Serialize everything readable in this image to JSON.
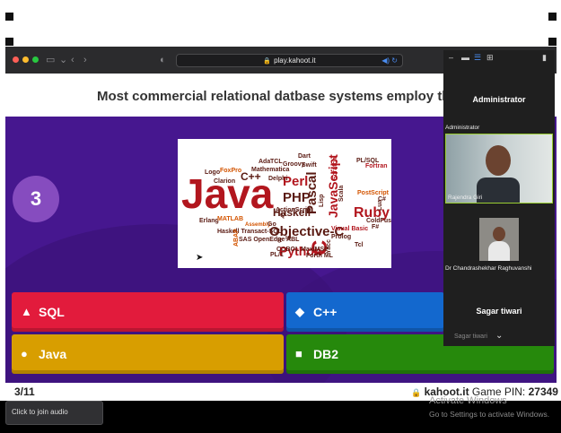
{
  "browser": {
    "url": "play.kahoot.it",
    "traffic_lights": [
      "#ff5f57",
      "#febc2e",
      "#28c840"
    ]
  },
  "question": {
    "text": "Most commercial relational datbase systems employ the langu",
    "timer": "3",
    "counter": "3/11"
  },
  "word_cloud": [
    {
      "t": "Java",
      "c": "#b2161e"
    },
    {
      "t": "Perl",
      "c": "#b2161e"
    },
    {
      "t": "PHP",
      "c": "#5a1a12"
    },
    {
      "t": "Haskell",
      "c": "#5a1a12"
    },
    {
      "t": "Pascal",
      "c": "#5a1a12"
    },
    {
      "t": "JavaScript",
      "c": "#b2161e"
    },
    {
      "t": "Ruby",
      "c": "#b2161e"
    },
    {
      "t": "Python",
      "c": "#b2161e"
    },
    {
      "t": "Objective-C",
      "c": "#5a1a12"
    },
    {
      "t": "C++",
      "c": "#5a1a12"
    },
    {
      "t": "C",
      "c": "#b2161e"
    },
    {
      "t": "Logo",
      "c": "#5a1a12"
    },
    {
      "t": "FoxPro",
      "c": "#d35400"
    },
    {
      "t": "Clarion",
      "c": "#5a1a12"
    },
    {
      "t": "Ada",
      "c": "#5a1a12"
    },
    {
      "t": "TCL",
      "c": "#5a1a12"
    },
    {
      "t": "Groovy",
      "c": "#5a1a12"
    },
    {
      "t": "Swift",
      "c": "#5a1a12"
    },
    {
      "t": "Dart",
      "c": "#5a1a12"
    },
    {
      "t": "Mathematica",
      "c": "#5a1a12"
    },
    {
      "t": "Delphi",
      "c": "#5a1a12"
    },
    {
      "t": "Scratch",
      "c": "#b2161e"
    },
    {
      "t": "Fortran",
      "c": "#b2161e"
    },
    {
      "t": "PL/SQL",
      "c": "#5a1a12"
    },
    {
      "t": "Scala",
      "c": "#5a1a12"
    },
    {
      "t": "PostScript",
      "c": "#d35400"
    },
    {
      "t": "C#",
      "c": "#5a1a12"
    },
    {
      "t": "ColdFusion",
      "c": "#5a1a12"
    },
    {
      "t": "Erlang",
      "c": "#5a1a12"
    },
    {
      "t": "MATLAB",
      "c": "#d35400"
    },
    {
      "t": "Assembly",
      "c": "#d35400"
    },
    {
      "t": "Haskell Transact-SQL",
      "c": "#5a1a12"
    },
    {
      "t": "SAS OpenEdge ABL",
      "c": "#5a1a12"
    },
    {
      "t": "COBOL Max/MSP",
      "c": "#5a1a12"
    },
    {
      "t": "PL/1",
      "c": "#5a1a12"
    },
    {
      "t": "ABAP",
      "c": "#d35400"
    },
    {
      "t": "Forth ML",
      "c": "#5a1a12"
    },
    {
      "t": "Visual Basic",
      "c": "#b2161e"
    },
    {
      "t": "Prolog",
      "c": "#5a1a12"
    },
    {
      "t": "F#",
      "c": "#5a1a12"
    },
    {
      "t": "Tcl",
      "c": "#5a1a12"
    },
    {
      "t": "Lua",
      "c": "#5a1a12"
    },
    {
      "t": "ActionScript",
      "c": "#5a1a12"
    },
    {
      "t": "Lisp",
      "c": "#5a1a12"
    },
    {
      "t": "Yacc",
      "c": "#5a1a12"
    },
    {
      "t": "Go",
      "c": "#5a1a12"
    },
    {
      "t": "Q",
      "c": "#5a1a12"
    },
    {
      "t": "R",
      "c": "#5a1a12"
    },
    {
      "t": "io",
      "c": "#5a1a12"
    }
  ],
  "answers": [
    {
      "label": "SQL",
      "shape": "▲",
      "color": "#e21b3c"
    },
    {
      "label": "C++",
      "shape": "◆",
      "color": "#1368ce"
    },
    {
      "label": "Java",
      "shape": "●",
      "color": "#d89e00"
    },
    {
      "label": "DB2",
      "shape": "■",
      "color": "#26890c"
    }
  ],
  "footer": {
    "brand": "kahoot.it",
    "pin_label": "Game PIN:",
    "pin": "27349"
  },
  "join_audio": "Click to join audio",
  "watermark": {
    "title": "Activate Windows",
    "subtitle": "Go to Settings to activate Windows."
  },
  "participants": {
    "host_tile": "Administrator",
    "host_caption": "Administrator",
    "p1": "Rajendra Giri",
    "p2": "Dr Chandrashekhar Raghuvanshi",
    "p3": "Sagar tiwari",
    "p3_caption": "Sagar tiwari"
  }
}
